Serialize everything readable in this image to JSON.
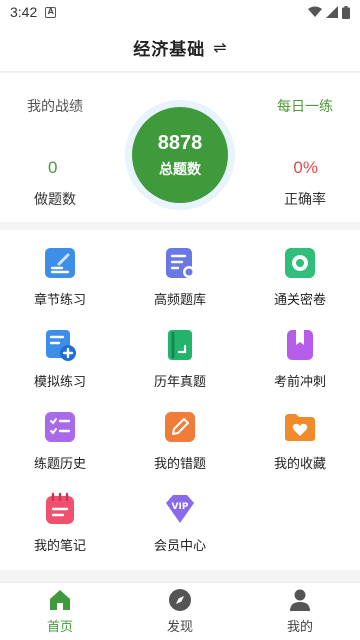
{
  "status_bar": {
    "time": "3:42",
    "notif_glyph": "A"
  },
  "header": {
    "title": "经济基础",
    "swap_glyph": "⇌"
  },
  "stats": {
    "my_record_label": "我的战绩",
    "daily_label": "每日一练",
    "total_value": "8878",
    "total_label": "总题数",
    "done_value": "0",
    "done_label": "做题数",
    "rate_value": "0%",
    "rate_label": "正确率"
  },
  "grid": [
    {
      "label": "章节练习",
      "icon": "edit-note-icon",
      "color": "#3d8ee8"
    },
    {
      "label": "高频题库",
      "icon": "list-settings-icon",
      "color": "#6a78e6"
    },
    {
      "label": "通关密卷",
      "icon": "camera-frame-icon",
      "color": "#2fbf7a"
    },
    {
      "label": "模拟练习",
      "icon": "doc-add-icon",
      "color": "#3d8ee8"
    },
    {
      "label": "历年真题",
      "icon": "book-icon",
      "color": "#23b36b"
    },
    {
      "label": "考前冲刺",
      "icon": "bookmark-book-icon",
      "color": "#b55ce8"
    },
    {
      "label": "练题历史",
      "icon": "checklist-icon",
      "color": "#a86ae8"
    },
    {
      "label": "我的错题",
      "icon": "pencil-square-icon",
      "color": "#f07c3a"
    },
    {
      "label": "我的收藏",
      "icon": "heart-folder-icon",
      "color": "#f08a2a"
    },
    {
      "label": "我的笔记",
      "icon": "notebook-icon",
      "color": "#f0506e"
    },
    {
      "label": "会员中心",
      "icon": "vip-diamond-icon",
      "color": "#8a6ae8"
    }
  ],
  "tabs": [
    {
      "label": "首页",
      "icon": "home-icon",
      "active": true
    },
    {
      "label": "发现",
      "icon": "compass-icon",
      "active": false
    },
    {
      "label": "我的",
      "icon": "user-icon",
      "active": false
    }
  ],
  "colors": {
    "brand_green": "#3f9a3c",
    "danger": "#e04a4a"
  }
}
